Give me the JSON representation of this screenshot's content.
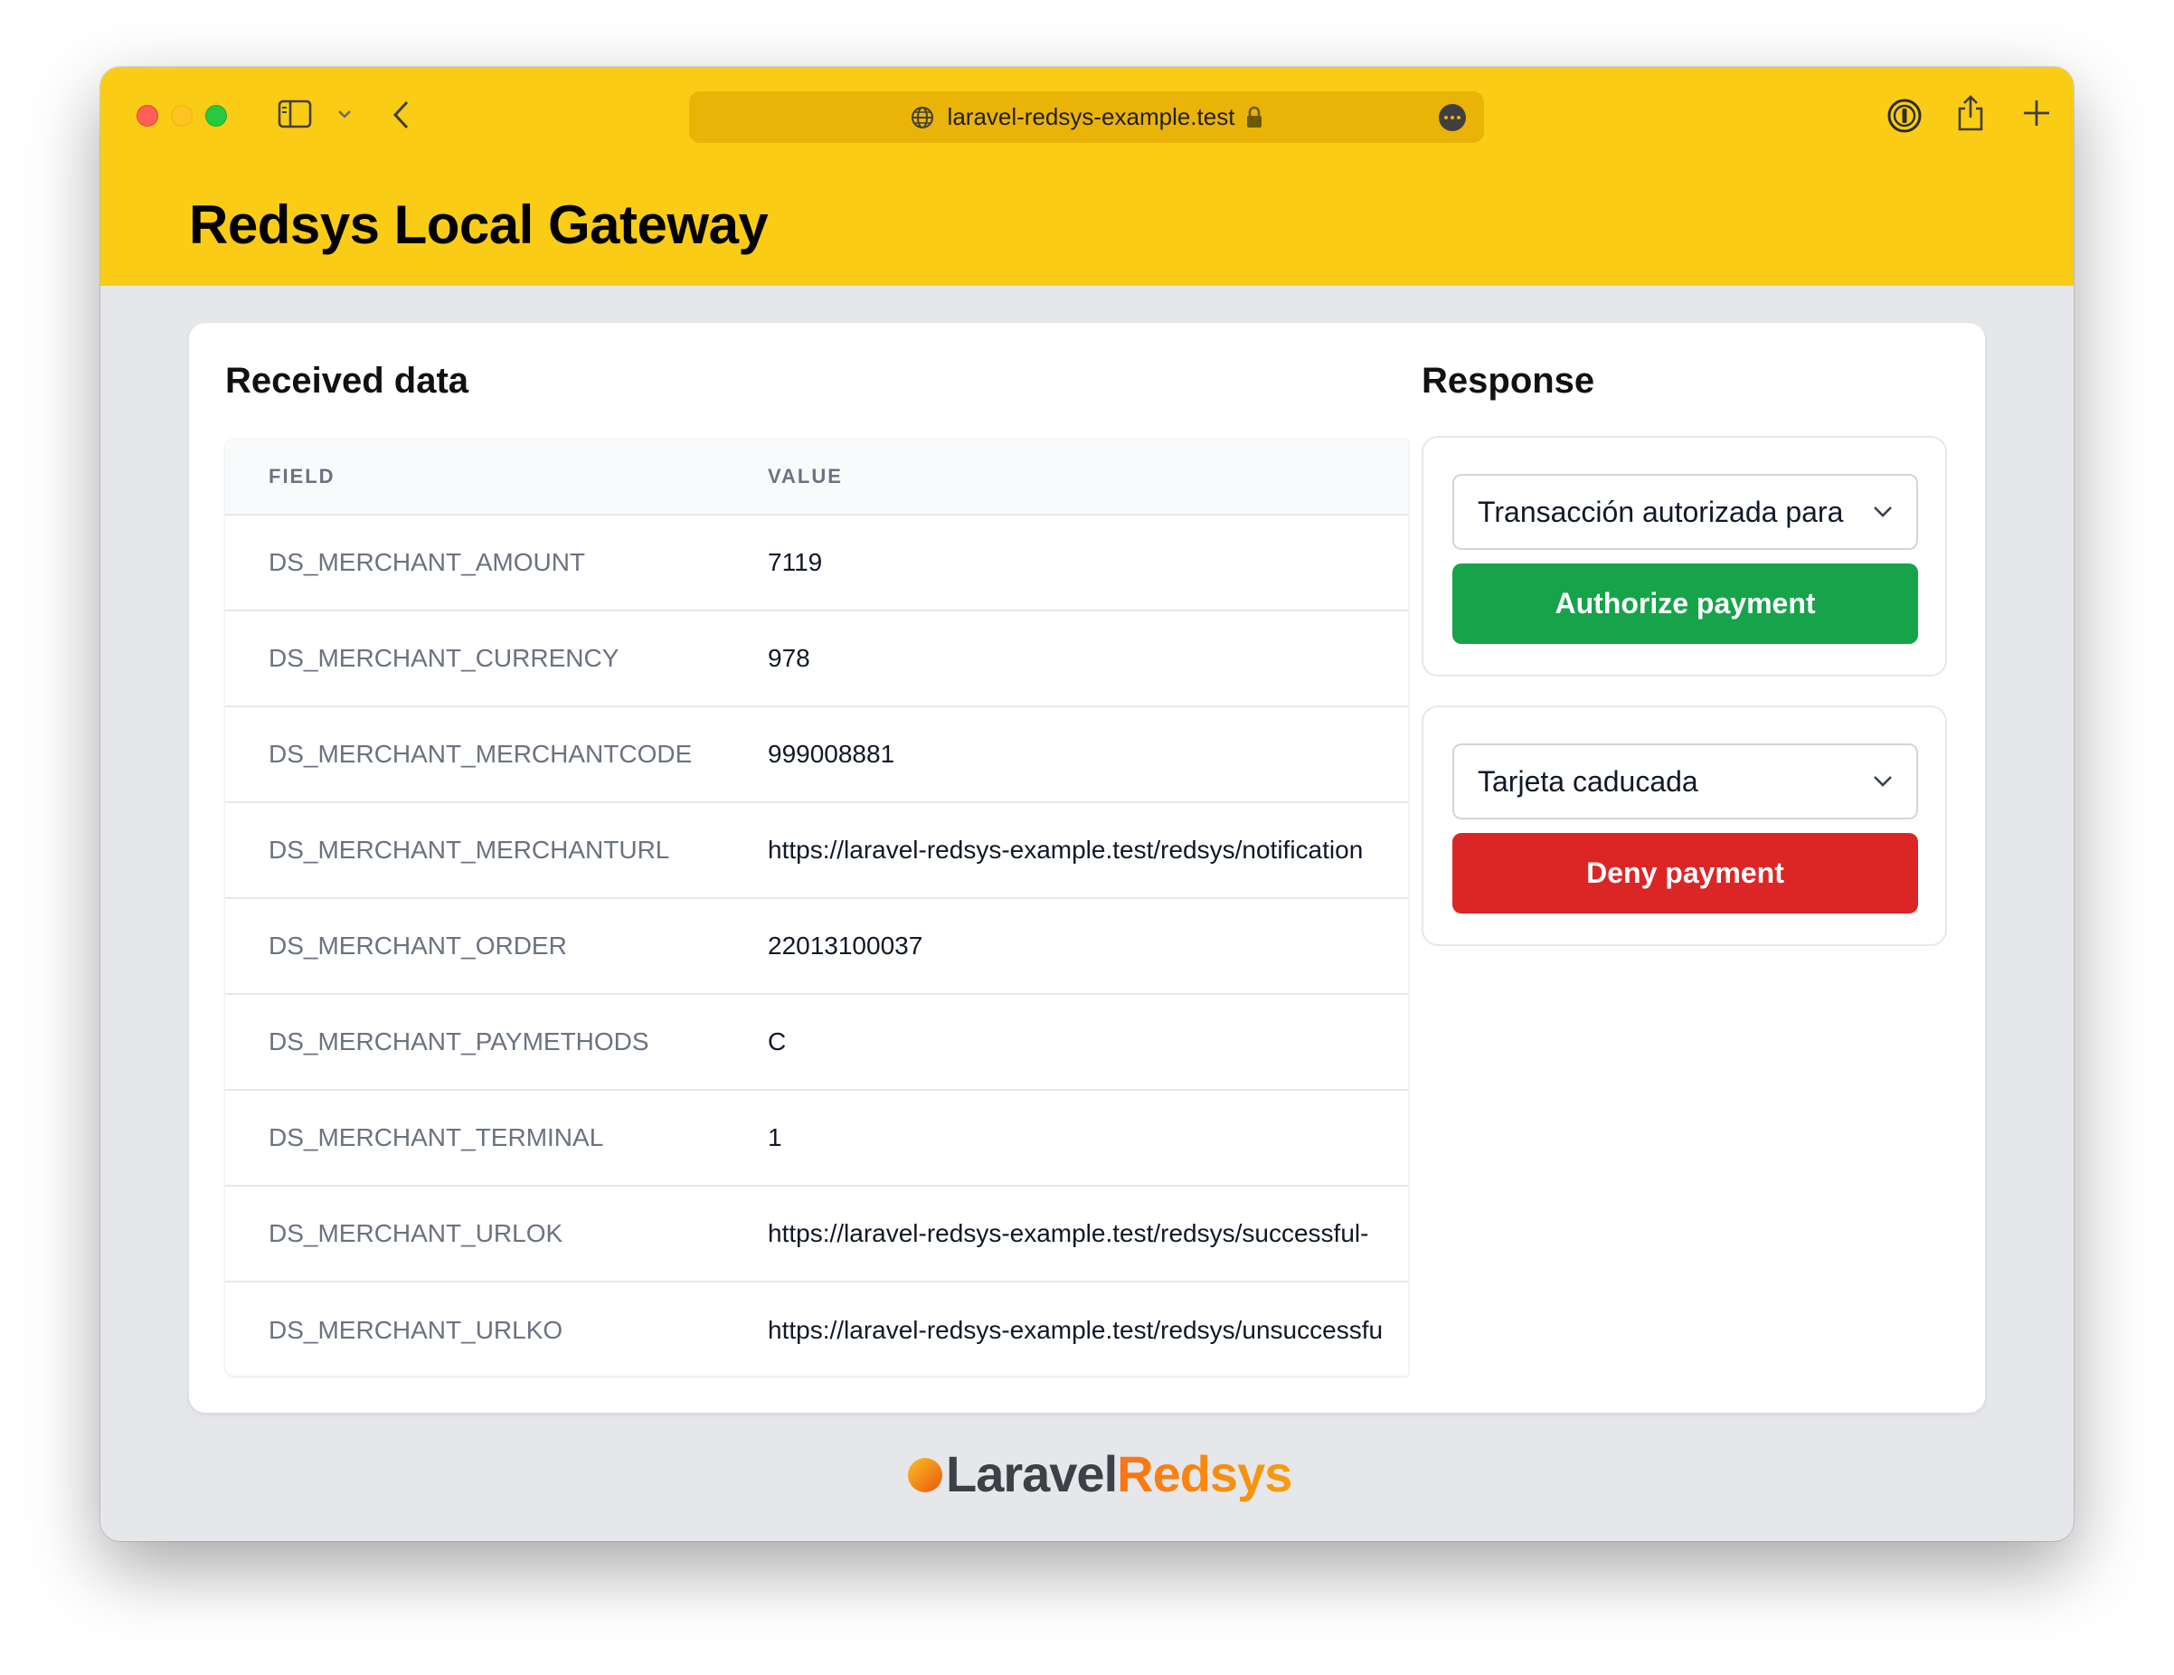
{
  "browser": {
    "url": "laravel-redsys-example.test"
  },
  "site": {
    "title": "Redsys Local Gateway"
  },
  "received": {
    "title": "Received data",
    "columns": [
      "FIELD",
      "VALUE"
    ],
    "rows": [
      {
        "field": "DS_MERCHANT_AMOUNT",
        "value": "7119"
      },
      {
        "field": "DS_MERCHANT_CURRENCY",
        "value": "978"
      },
      {
        "field": "DS_MERCHANT_MERCHANTCODE",
        "value": "999008881"
      },
      {
        "field": "DS_MERCHANT_MERCHANTURL",
        "value": "https://laravel-redsys-example.test/redsys/notification"
      },
      {
        "field": "DS_MERCHANT_ORDER",
        "value": "22013100037"
      },
      {
        "field": "DS_MERCHANT_PAYMETHODS",
        "value": "C"
      },
      {
        "field": "DS_MERCHANT_TERMINAL",
        "value": "1"
      },
      {
        "field": "DS_MERCHANT_URLOK",
        "value": "https://laravel-redsys-example.test/redsys/successful-"
      },
      {
        "field": "DS_MERCHANT_URLKO",
        "value": "https://laravel-redsys-example.test/redsys/unsuccessfu"
      }
    ]
  },
  "response": {
    "title": "Response",
    "authorize": {
      "selected": "Transacción autorizada para",
      "button": "Authorize payment",
      "color": "#16a34a"
    },
    "deny": {
      "selected": "Tarjeta caducada",
      "button": "Deny payment",
      "color": "#dc2626"
    }
  },
  "footer": {
    "logo_part1": "Laravel",
    "logo_part2": "Redsys"
  },
  "colors": {
    "header": "#facc15",
    "address_bar": "#eab308",
    "background": "#e5e7eb"
  }
}
